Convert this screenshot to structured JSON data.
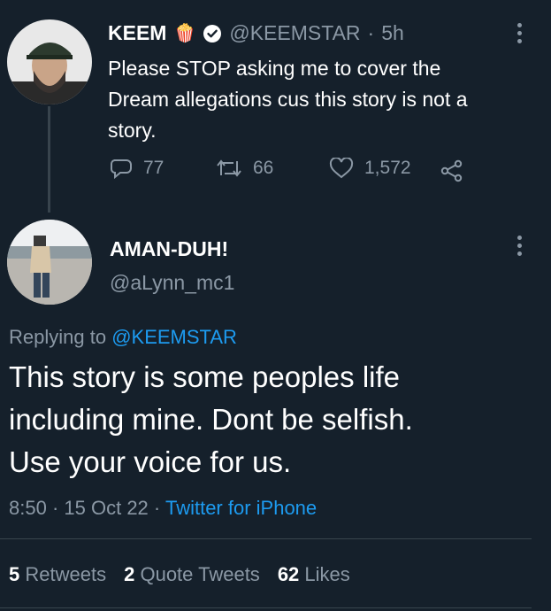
{
  "first_tweet": {
    "name": "KEEM",
    "emoji": "🍿",
    "handle": "@KEEMSTAR",
    "time": "5h",
    "text_lines": [
      "Please STOP asking me to cover the",
      "Dream allegations cus this story is not a",
      "story."
    ],
    "replies": "77",
    "retweets": "66",
    "likes": "1,572"
  },
  "reply": {
    "name": "AMAN-DUH!",
    "handle": "@aLynn_mc1",
    "replying_label": "Replying to",
    "replying_to": "@KEEMSTAR",
    "text_lines": [
      "This story is some peoples life",
      "including mine. Dont be selfish.",
      "Use your voice for us."
    ],
    "time": "8:50",
    "date": "15 Oct 22",
    "client": "Twitter for iPhone"
  },
  "stats": {
    "retweets_count": "5",
    "retweets_label": "Retweets",
    "quotes_count": "2",
    "quotes_label": "Quote Tweets",
    "likes_count": "62",
    "likes_label": "Likes"
  },
  "colors": {
    "background": "#15202b",
    "accent": "#1d9bf0",
    "muted": "#8b98a5"
  }
}
